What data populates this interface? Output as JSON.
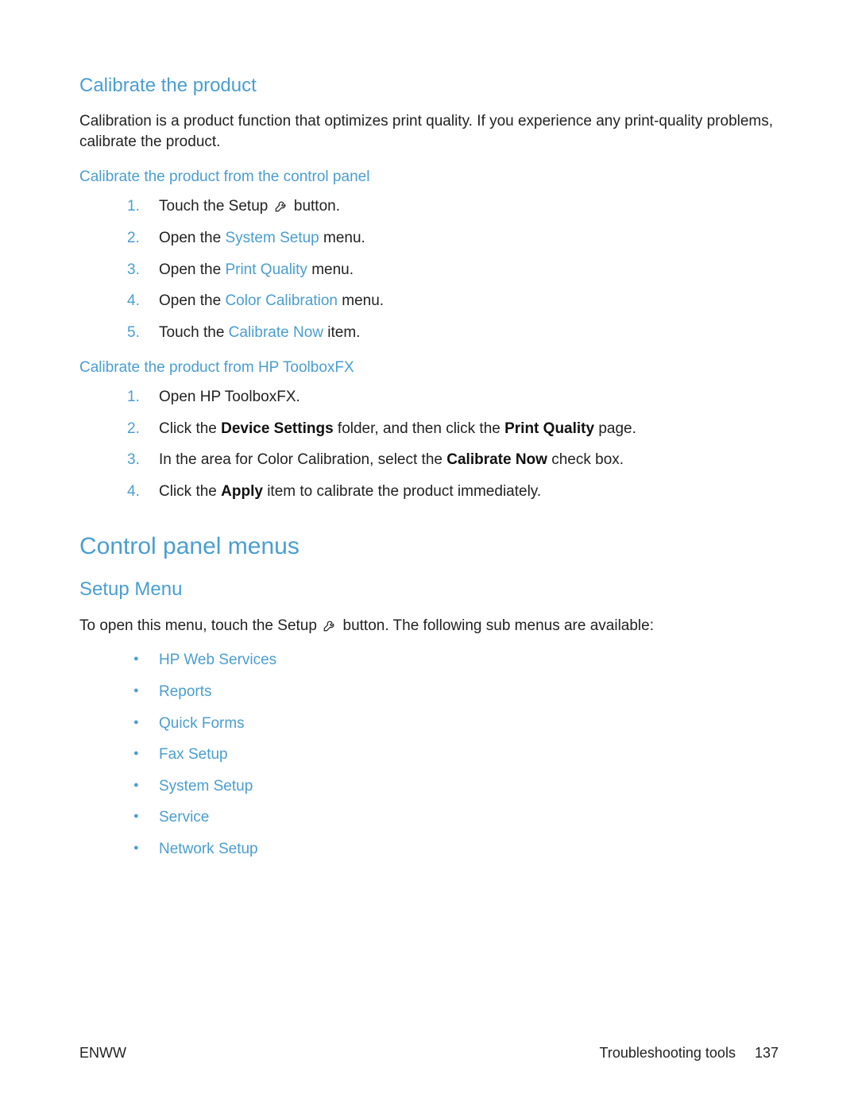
{
  "sections": {
    "calibrate": {
      "title": "Calibrate the product",
      "intro": "Calibration is a product function that optimizes print quality. If you experience any print-quality problems, calibrate the product.",
      "from_panel": {
        "title": "Calibrate the product from the control panel",
        "steps": {
          "s1_a": "Touch the Setup ",
          "s1_b": " button.",
          "s2_a": "Open the ",
          "s2_link": "System Setup",
          "s2_b": " menu.",
          "s3_a": "Open the ",
          "s3_link": "Print Quality",
          "s3_b": " menu.",
          "s4_a": "Open the ",
          "s4_link": "Color Calibration",
          "s4_b": " menu.",
          "s5_a": "Touch the ",
          "s5_link": "Calibrate Now",
          "s5_b": " item."
        }
      },
      "from_toolbox": {
        "title": "Calibrate the product from HP ToolboxFX",
        "steps": {
          "s1": "Open HP ToolboxFX.",
          "s2_a": "Click the ",
          "s2_b1": "Device Settings",
          "s2_c": " folder, and then click the ",
          "s2_b2": "Print Quality",
          "s2_d": " page.",
          "s3_a": "In the area for Color Calibration, select the ",
          "s3_b1": "Calibrate Now",
          "s3_c": " check box.",
          "s4_a": "Click the ",
          "s4_b1": "Apply",
          "s4_c": " item to calibrate the product immediately."
        }
      }
    },
    "control_panel": {
      "title": "Control panel menus",
      "setup_menu": {
        "title": "Setup Menu",
        "intro_a": "To open this menu, touch the Setup ",
        "intro_b": " button. The following sub menus are available:",
        "items": {
          "i0": "HP Web Services",
          "i1": "Reports",
          "i2": "Quick Forms",
          "i3": "Fax Setup",
          "i4": "System Setup",
          "i5": "Service",
          "i6": "Network Setup"
        }
      }
    }
  },
  "footer": {
    "left": "ENWW",
    "section": "Troubleshooting tools",
    "page": "137"
  }
}
